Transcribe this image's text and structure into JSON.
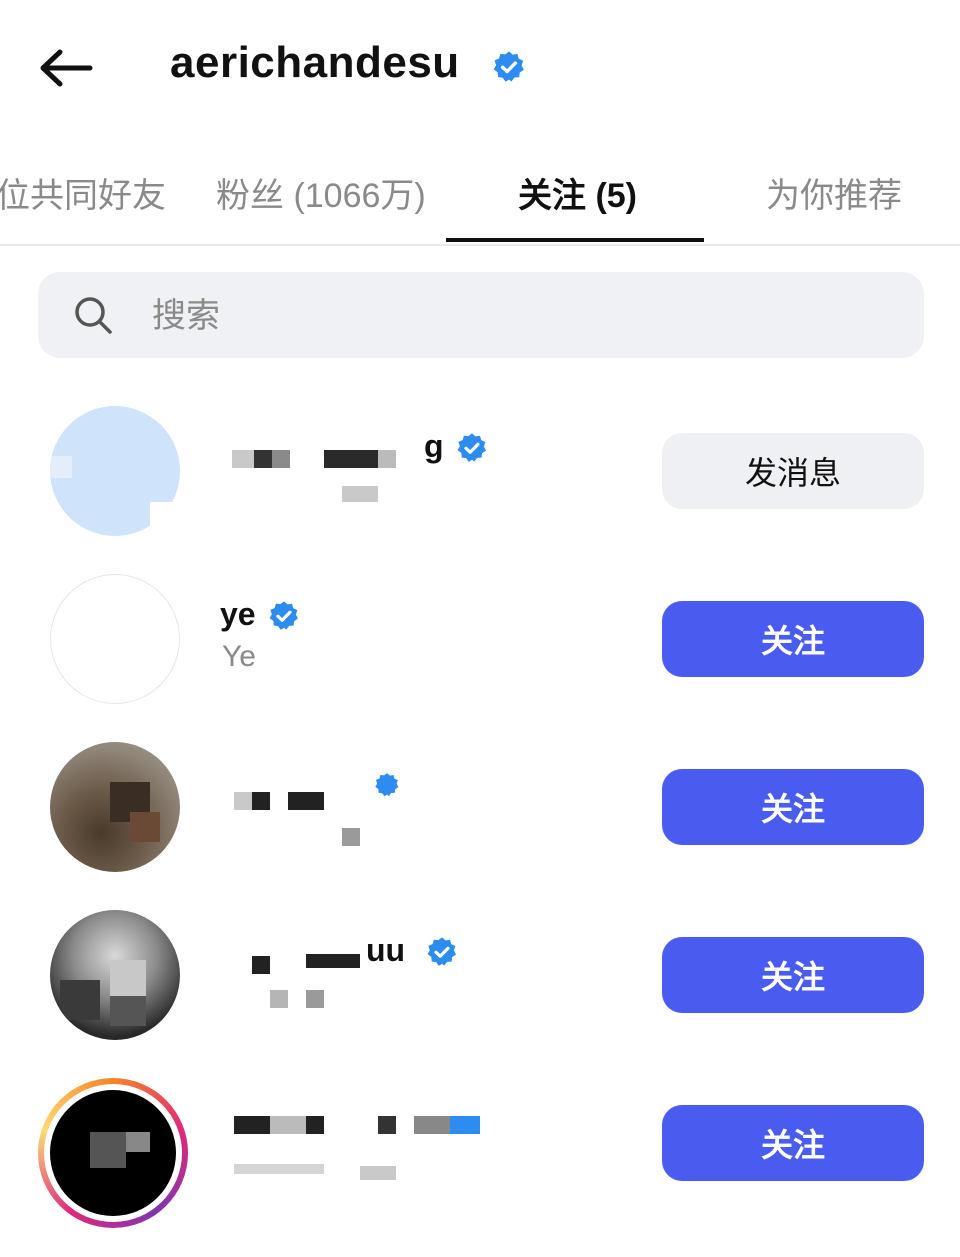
{
  "header": {
    "title": "aerichandesu",
    "back_icon": "arrow-left-icon",
    "verified_icon": "verified-badge-icon"
  },
  "tabs": [
    {
      "label": "位共同好友"
    },
    {
      "label": "粉丝 (1066万)"
    },
    {
      "label": "关注 (5)"
    },
    {
      "label": "为你推荐"
    }
  ],
  "search": {
    "placeholder": "搜索",
    "value": ""
  },
  "following": [
    {
      "name": "g",
      "subtitle": "",
      "verified": true,
      "action": "发消息"
    },
    {
      "name": "ye",
      "subtitle": "Ye",
      "verified": true,
      "action": "关注"
    },
    {
      "name": "",
      "subtitle": "",
      "verified": true,
      "action": "关注"
    },
    {
      "name": "uu",
      "subtitle": "",
      "verified": true,
      "action": "关注"
    },
    {
      "name": "",
      "subtitle": "",
      "verified": false,
      "action": "关注"
    }
  ],
  "colors": {
    "follow_button": "#4a5cf0",
    "message_button": "#eff0f3",
    "verified": "#2d8cf0"
  }
}
